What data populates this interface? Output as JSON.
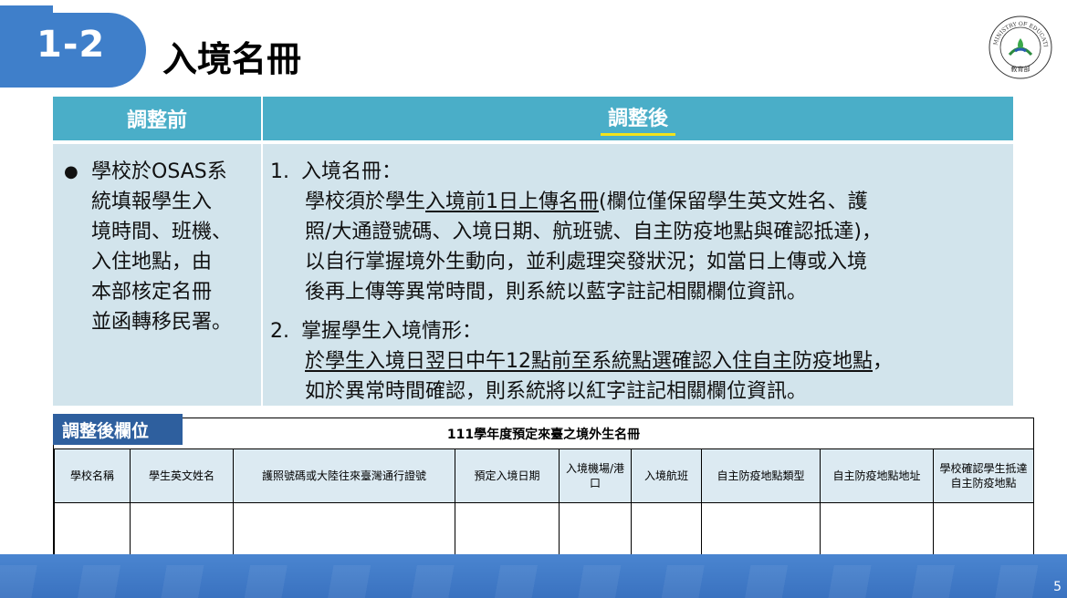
{
  "header": {
    "section_number": "1-2",
    "title": "入境名冊",
    "logo_text": "MINISTRY OF EDUCATION",
    "logo_chinese": "教育部"
  },
  "comparison": {
    "before_header": "調整前",
    "after_header": "調整後",
    "before_lines": [
      "學校於OSAS系",
      "統填報學生入",
      "境時間、班機、",
      "入住地點，由",
      "本部核定名冊",
      "並函轉移民署。"
    ],
    "after": {
      "item1": {
        "num": "1.",
        "title": "入境名冊：",
        "l1_a": "學校須於學生",
        "l1_u": "入境前1日上傳名冊",
        "l1_b": "(欄位僅保留學生英文姓名、護",
        "l2": "照/大通證號碼、入境日期、航班號、自主防疫地點與確認抵達)，",
        "l3": "以自行掌握境外生動向，並利處理突發狀況；如當日上傳或入境",
        "l4": "後再上傳等異常時間，則系統以藍字註記相關欄位資訊。"
      },
      "item2": {
        "num": "2.",
        "title": "掌握學生入境情形：",
        "l1_u": "於學生入境日翌日中午12點前至系統點選確認入住自主防疫地點",
        "l1_b": "，",
        "l2": "如於異常時間確認，則系統將以紅字註記相關欄位資訊。"
      }
    }
  },
  "adjusted_fields": {
    "label": "調整後欄位",
    "caption": "111學年度預定來臺之境外生名冊",
    "columns": [
      "學校名稱",
      "學生英文姓名",
      "護照號碼或大陸往來臺灣通行證號",
      "預定入境日期",
      "入境機場/港口",
      "入境航班",
      "自主防疫地點類型",
      "自主防疫地點地址",
      "學校確認學生抵達自主防疫地點"
    ]
  },
  "footer": {
    "page_number": "5"
  },
  "colors": {
    "title_tab": "#3f7fca",
    "table_header": "#4aaec8",
    "table_body": "#d2e4ec",
    "label_bg": "#2e5f9e",
    "highlight_underline": "#f3e31b"
  }
}
